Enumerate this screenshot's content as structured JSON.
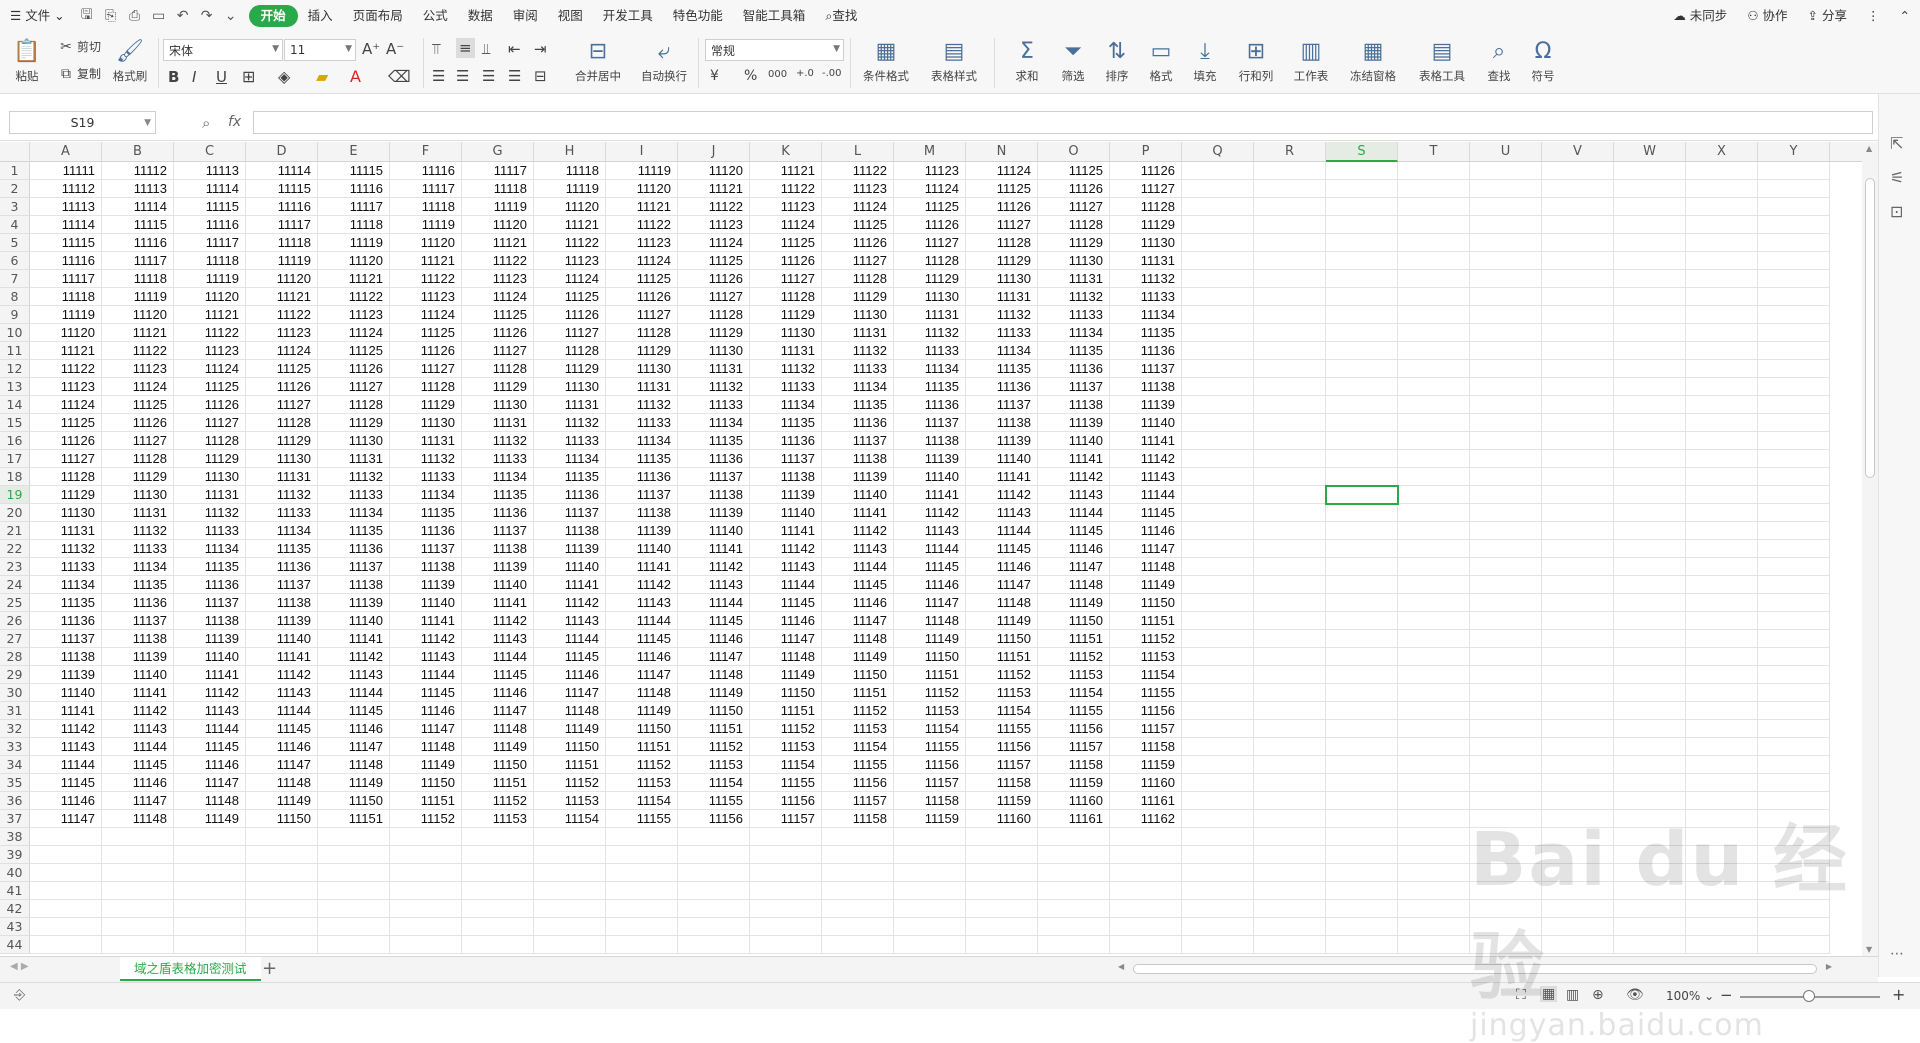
{
  "menubar": {
    "file_menu": "文件",
    "tabs": [
      "开始",
      "插入",
      "页面布局",
      "公式",
      "数据",
      "审阅",
      "视图",
      "开发工具",
      "特色功能",
      "智能工具箱"
    ],
    "active_tab": "开始",
    "search": "查找",
    "sync": "未同步",
    "collab": "协作",
    "share": "分享"
  },
  "ribbon": {
    "paste": "粘贴",
    "cut": "剪切",
    "copy": "复制",
    "format_painter": "格式刷",
    "font_name": "宋体",
    "font_size": "11",
    "merge_center": "合并居中",
    "wrap_text": "自动换行",
    "number_format": "常规",
    "currency": "¥",
    "percent": "%",
    "thousands": "000",
    "inc_decimal": "+0\n.00",
    "dec_decimal": "-.00",
    "conditional_format": "条件格式",
    "table_style": "表格样式",
    "sum": "求和",
    "filter": "筛选",
    "sort": "排序",
    "format": "格式",
    "fill": "填充",
    "row_col": "行和列",
    "worksheet": "工作表",
    "freeze": "冻结窗格",
    "table_tools": "表格工具",
    "find": "查找",
    "symbol": "符号"
  },
  "formulabar": {
    "name_box": "S19",
    "fx": "fx",
    "formula": ""
  },
  "columns": [
    "A",
    "B",
    "C",
    "D",
    "E",
    "F",
    "G",
    "H",
    "I",
    "J",
    "K",
    "L",
    "M",
    "N",
    "O",
    "P",
    "Q",
    "R",
    "S",
    "T",
    "U",
    "V",
    "W",
    "X",
    "Y"
  ],
  "selected_column": "S",
  "selected_row": 19,
  "row_count": 44,
  "data_rows": 37,
  "data_cols": 16,
  "data_start": 11111,
  "sheet": {
    "tab_name": "域之盾表格加密测试",
    "add": "+"
  },
  "statusbar": {
    "zoom": "100%"
  },
  "watermark": {
    "line1": "Bai du 经验",
    "line2": "jingyan.baidu.com"
  }
}
